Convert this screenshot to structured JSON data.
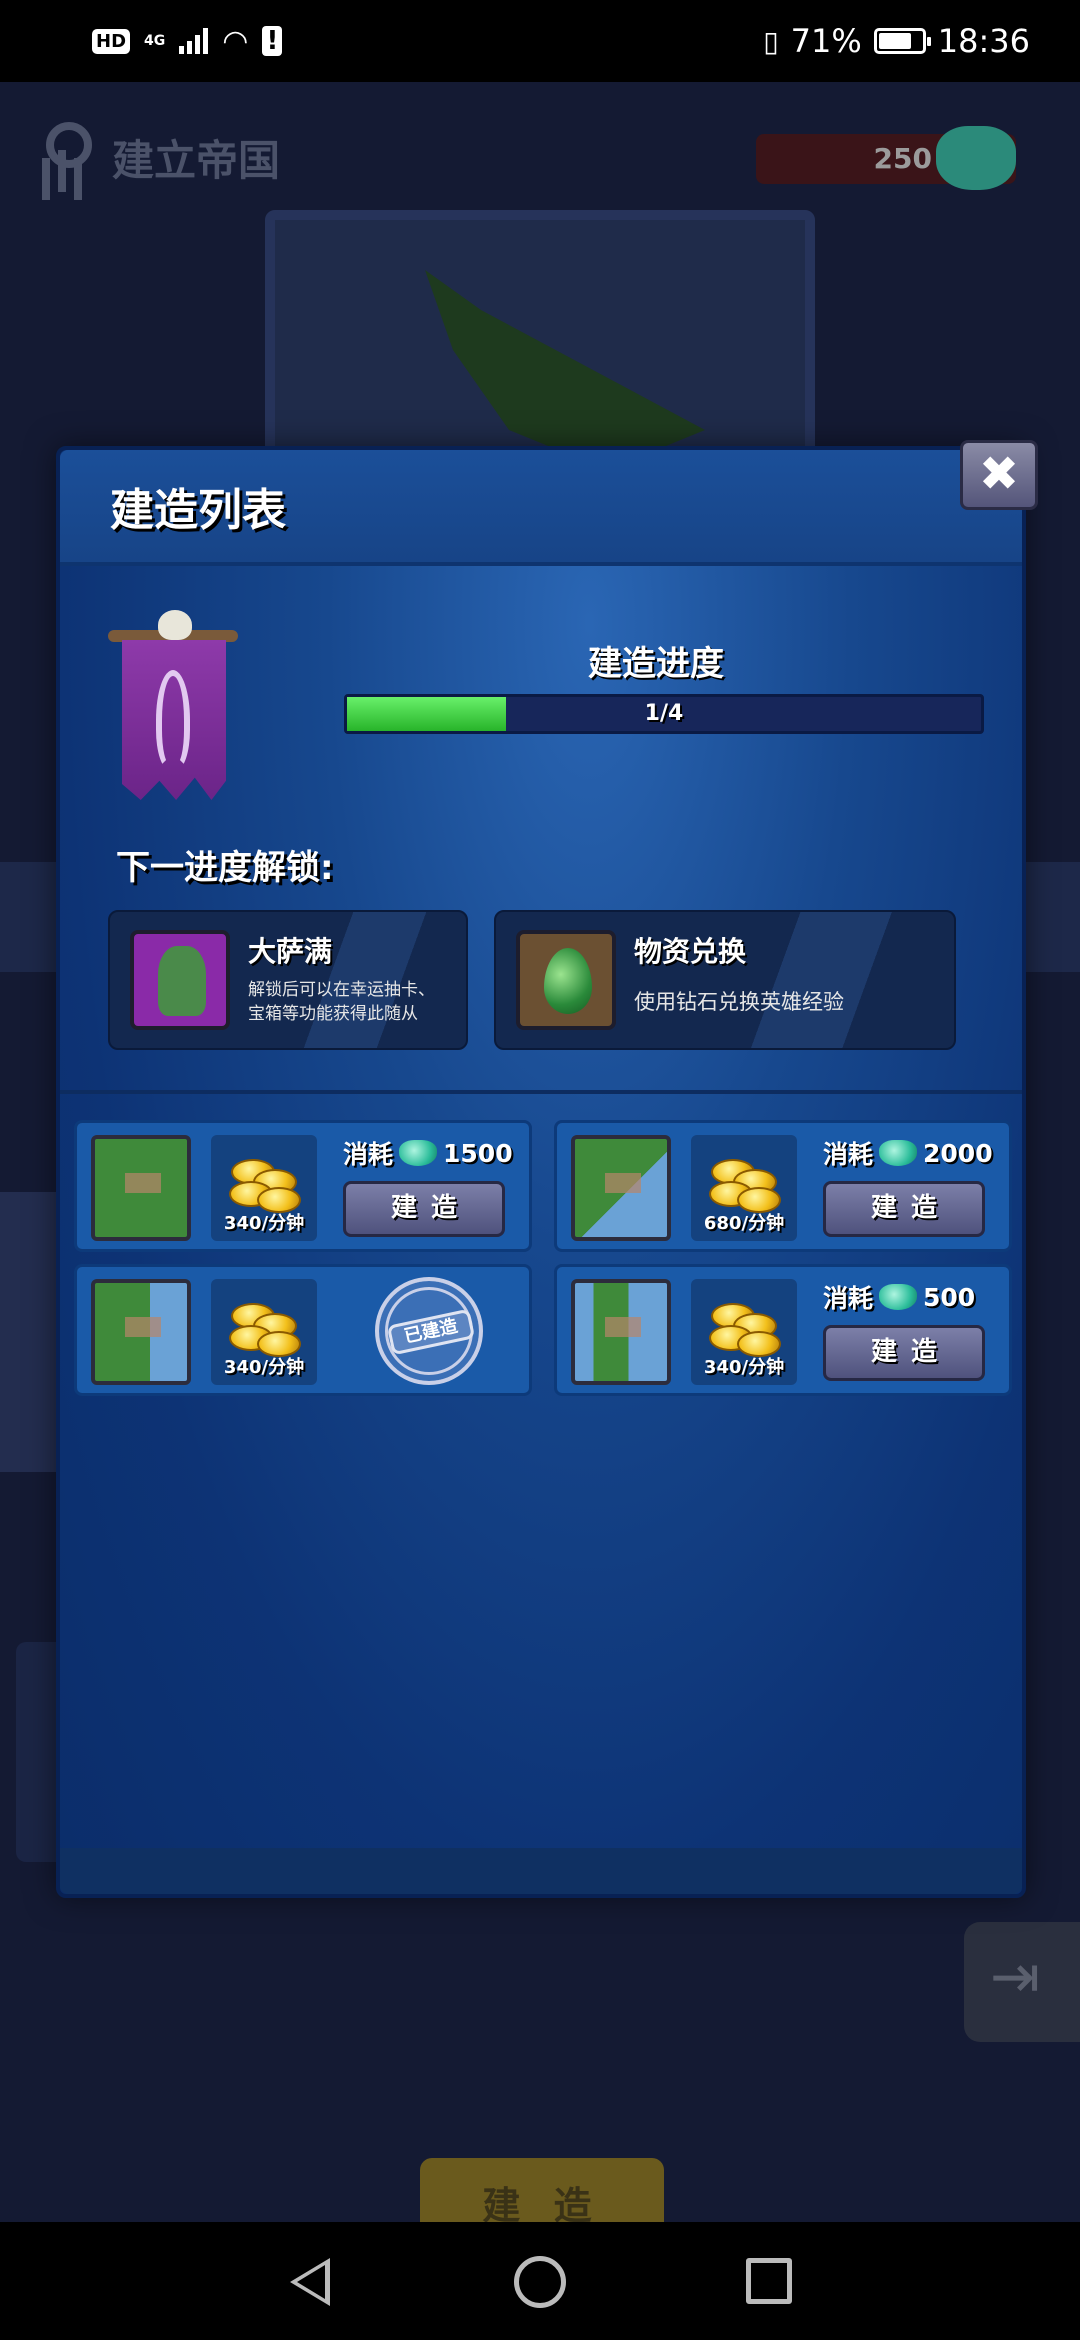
{
  "status_bar": {
    "hd": "HD",
    "network": "4G",
    "battery_percent": "71%",
    "time": "18:36"
  },
  "background": {
    "title": "建立帝国",
    "gem_count": "250",
    "build_button": "建 造"
  },
  "dialog": {
    "title": "建造列表",
    "close_label": "✖",
    "progress": {
      "label": "建造进度",
      "text": "1/4",
      "fraction": 0.25
    },
    "unlock_title": "下一进度解锁:",
    "unlocks": [
      {
        "name": "大萨满",
        "desc_line1": "解锁后可以在幸运抽卡、",
        "desc_line2": "宝箱等功能获得此随从",
        "icon": "shaman-portrait-icon"
      },
      {
        "name": "物资兑换",
        "desc": "使用钻石兑换英雄经验",
        "icon": "green-drop-icon"
      }
    ],
    "buildings": [
      {
        "rate": "340/分钟",
        "cost_label": "消耗",
        "cost": "1500",
        "button": "建造"
      },
      {
        "rate": "680/分钟",
        "cost_label": "消耗",
        "cost": "2000",
        "button": "建造"
      },
      {
        "rate": "340/分钟",
        "stamp": "已建造"
      },
      {
        "rate": "340/分钟",
        "cost_label": "消耗",
        "cost": "500",
        "button": "建造"
      }
    ]
  },
  "colors": {
    "dialog_bg": "#17488e",
    "progress_fill": "#3ad03c",
    "card_bg": "#1a5aa8",
    "button": "#6b6e98"
  }
}
